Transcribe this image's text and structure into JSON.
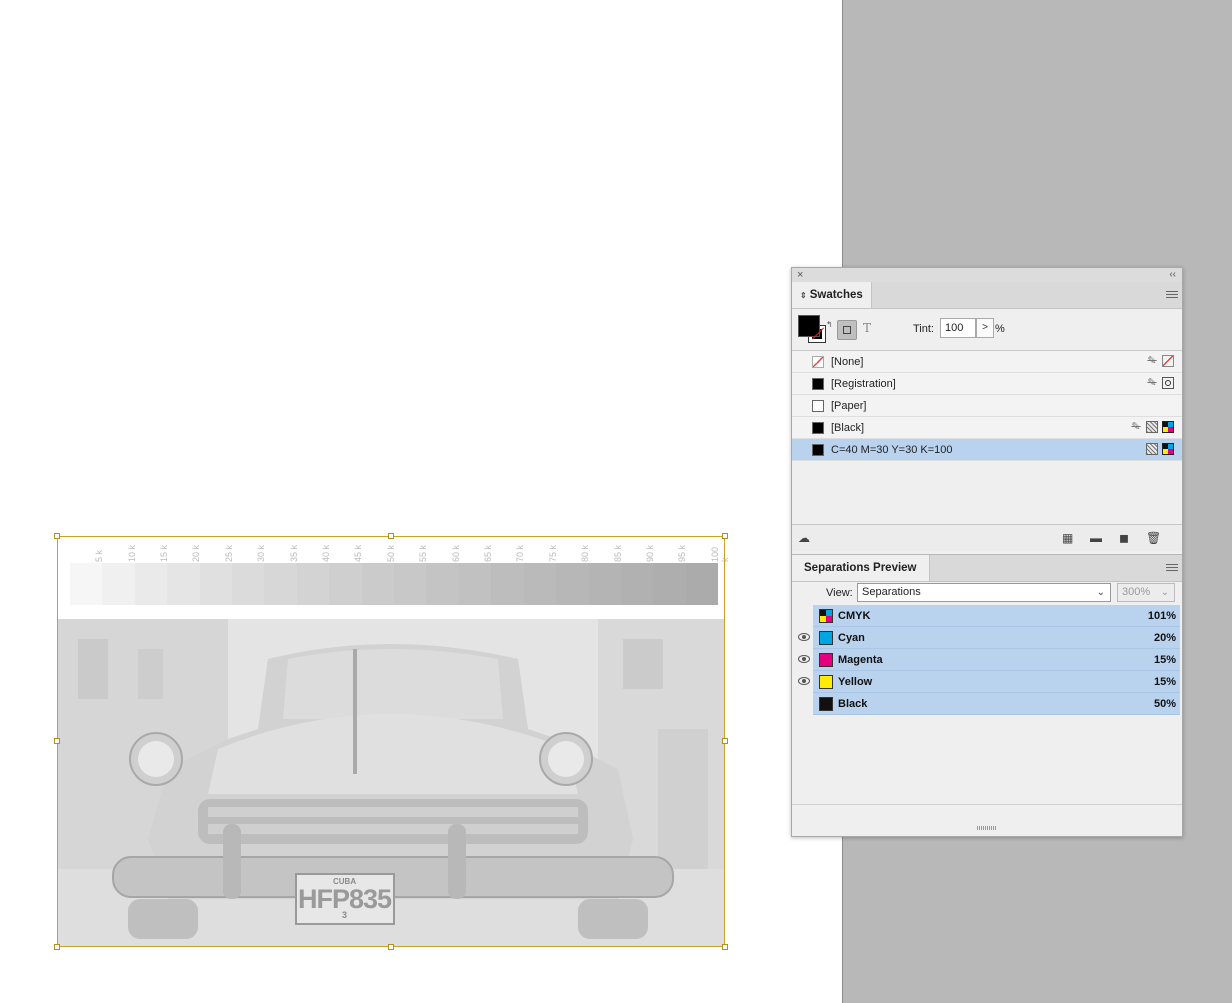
{
  "ramp": {
    "labels": [
      "5 k",
      "10 k",
      "15 k",
      "20 k",
      "25 k",
      "30 k",
      "35 k",
      "40 k",
      "45 k",
      "50 k",
      "55 k",
      "60 k",
      "65 k",
      "70 k",
      "75 k",
      "80 k",
      "85 k",
      "90 k",
      "95 k",
      "100 k"
    ],
    "shades": [
      "#f6f6f6",
      "#f0f0f0",
      "#eaeaea",
      "#e5e5e5",
      "#e0e0e0",
      "#dbdbdb",
      "#d7d7d7",
      "#d3d3d3",
      "#cfcfcf",
      "#cbcbcb",
      "#c8c8c8",
      "#c4c4c4",
      "#c1c1c1",
      "#bdbdbd",
      "#bababa",
      "#b7b7b7",
      "#b4b4b4",
      "#b1b1b1",
      "#aeaeae",
      "#ababab"
    ]
  },
  "photo": {
    "plate_top": "CUBA",
    "plate_main": "HFP835",
    "plate_bottom": "3"
  },
  "swatches_panel": {
    "tab_label": "Swatches",
    "close_glyph": "×",
    "collapse_glyph": "‹‹",
    "tint_label": "Tint:",
    "tint_value": "100",
    "tint_unit": "%",
    "text_format_glyph": "T",
    "items": [
      {
        "name": "[None]",
        "chip": "none",
        "icons": [
          "no-edit",
          "none"
        ]
      },
      {
        "name": "[Registration]",
        "chip": "#000000",
        "icons": [
          "no-edit",
          "registration"
        ]
      },
      {
        "name": "[Paper]",
        "chip": "#ffffff",
        "icons": []
      },
      {
        "name": "[Black]",
        "chip": "#000000",
        "icons": [
          "no-edit",
          "process",
          "cmyk"
        ]
      },
      {
        "name": "C=40 M=30 Y=30 K=100",
        "chip": "#000000",
        "icons": [
          "process",
          "cmyk"
        ],
        "selected": true
      }
    ]
  },
  "separations_panel": {
    "tab_label": "Separations Preview",
    "view_label": "View:",
    "view_value": "Separations",
    "zoom_value": "300%",
    "inks": [
      {
        "name": "CMYK",
        "percent": "101%",
        "visible": false,
        "chip": "cmyk"
      },
      {
        "name": "Cyan",
        "percent": "20%",
        "visible": true,
        "chip": "#00a6e2"
      },
      {
        "name": "Magenta",
        "percent": "15%",
        "visible": true,
        "chip": "#e6007e"
      },
      {
        "name": "Yellow",
        "percent": "15%",
        "visible": true,
        "chip": "#ffec00"
      },
      {
        "name": "Black",
        "percent": "50%",
        "visible": false,
        "chip": "#111111"
      }
    ]
  }
}
